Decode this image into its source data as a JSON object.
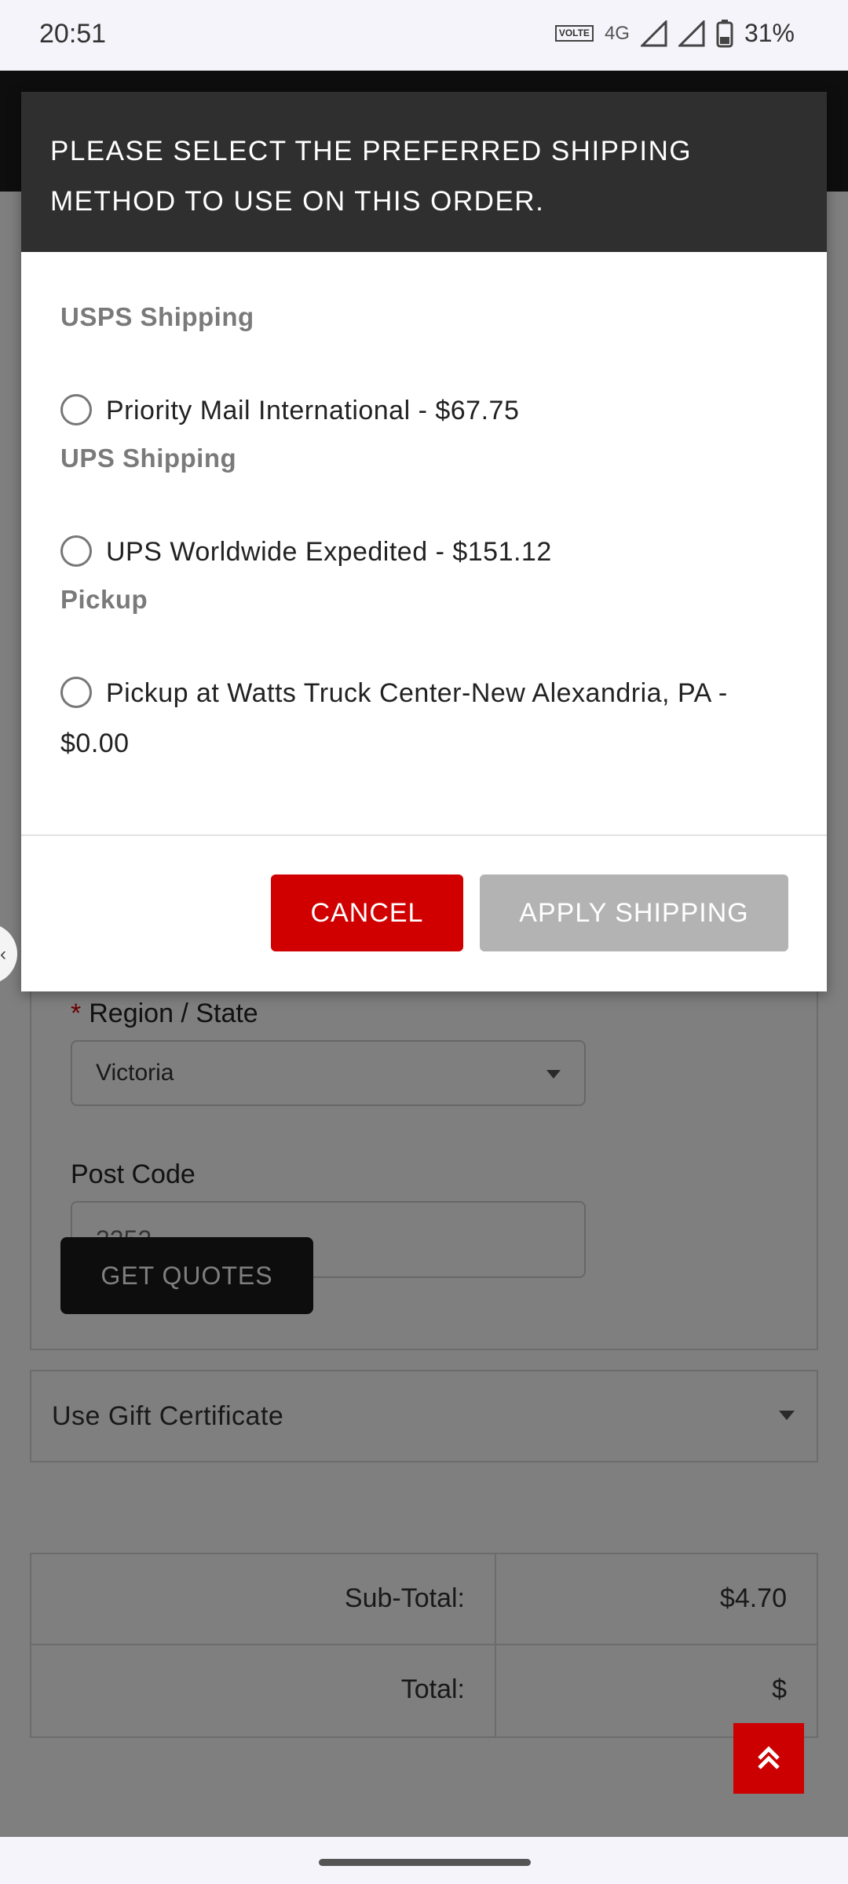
{
  "status_bar": {
    "time": "20:51",
    "volte_label": "VOLTE",
    "network_label": "4G",
    "battery_percent": "31%",
    "icons": [
      "volte-icon",
      "4g-icon",
      "signal-icon",
      "signal-icon",
      "battery-icon"
    ]
  },
  "modal": {
    "title": "PLEASE SELECT THE PREFERRED SHIPPING METHOD TO USE ON THIS ORDER.",
    "groups": [
      {
        "title": "USPS Shipping",
        "options": [
          {
            "label": "Priority Mail International - $67.75",
            "selected": false
          }
        ]
      },
      {
        "title": "UPS Shipping",
        "options": [
          {
            "label": "UPS Worldwide Expedited - $151.12",
            "selected": false
          }
        ]
      },
      {
        "title": "Pickup",
        "options": [
          {
            "label": "Pickup at Watts Truck Center-New Alexandria, PA - $0.00",
            "selected": false
          }
        ]
      }
    ],
    "cancel_label": "CANCEL",
    "apply_label": "APPLY SHIPPING"
  },
  "form": {
    "region_label": "Region / State",
    "region_required_mark": "*",
    "region_value": "Victoria",
    "postcode_label": "Post Code",
    "postcode_value": "3352",
    "get_quotes_label": "GET QUOTES"
  },
  "gift": {
    "label": "Use Gift Certificate"
  },
  "totals": [
    {
      "label": "Sub-Total:",
      "value": "$4.70"
    },
    {
      "label": "Total:",
      "value": "$"
    }
  ],
  "colors": {
    "accent_red": "#d10000",
    "modal_header": "#2f2f2f",
    "disabled_button": "#b3b3b3",
    "dark_button": "#1a1a1a"
  }
}
